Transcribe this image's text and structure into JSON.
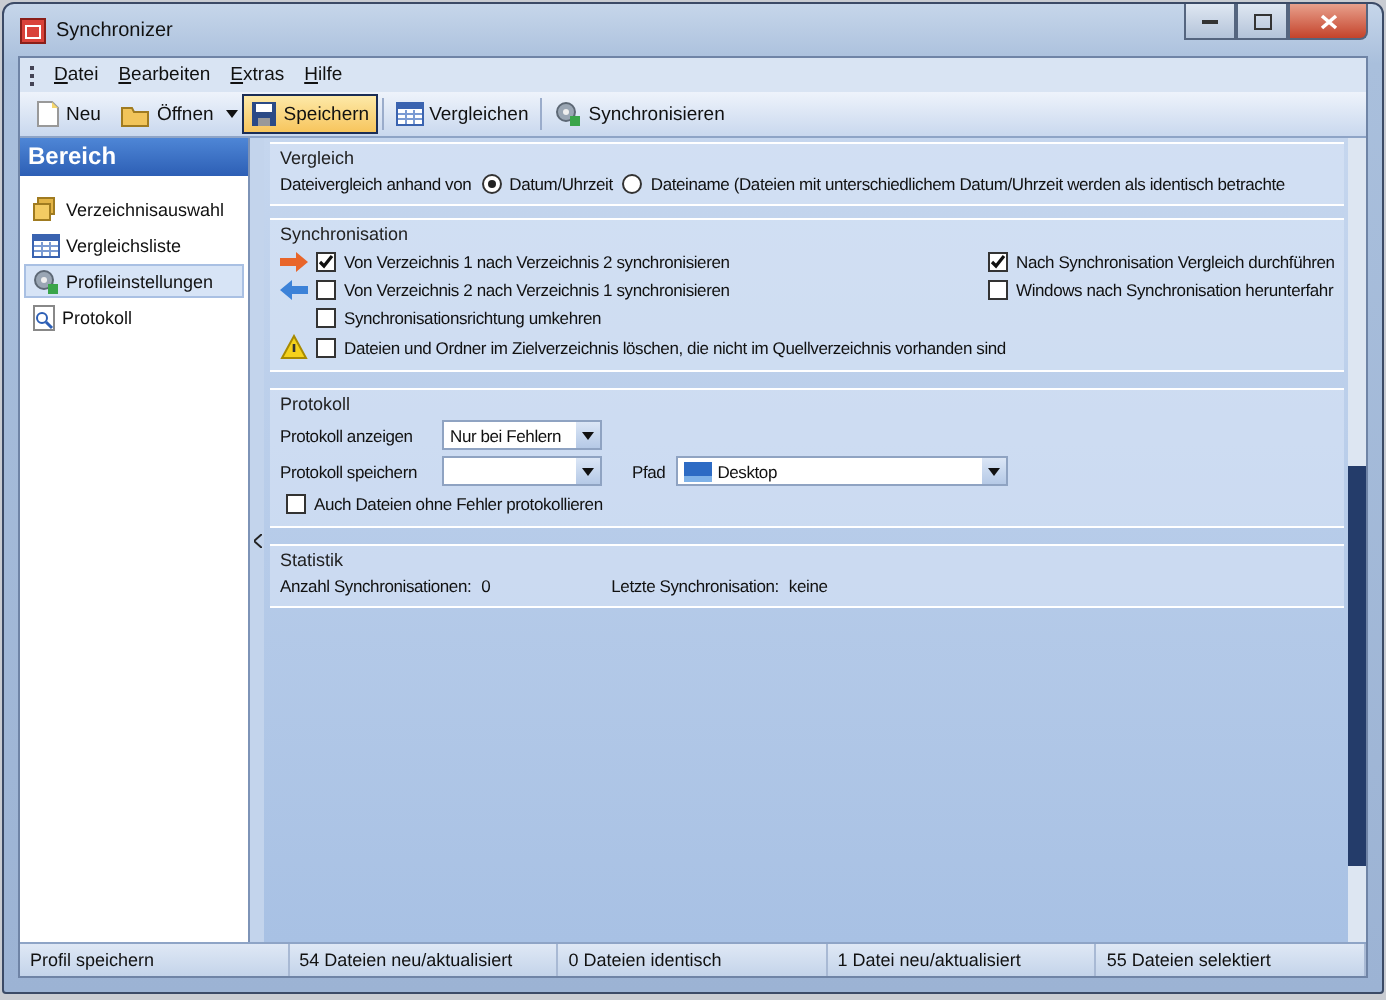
{
  "window": {
    "title": "Synchronizer"
  },
  "menu": [
    "Datei",
    "Bearbeiten",
    "Extras",
    "Hilfe"
  ],
  "toolbar": [
    {
      "label": "Neu",
      "selected": false
    },
    {
      "label": "Öffnen",
      "selected": false
    },
    {
      "label": "Speichern",
      "selected": true
    },
    {
      "label": "Vergleichen",
      "selected": false
    },
    {
      "label": "Synchronisieren",
      "selected": false
    }
  ],
  "sidebar": {
    "title": "Bereich",
    "items": [
      {
        "label": "Verzeichnisauswahl",
        "selected": false
      },
      {
        "label": "Vergleichsliste",
        "selected": false
      },
      {
        "label": "Profileinstellungen",
        "selected": true
      },
      {
        "label": "Protokoll",
        "selected": false
      }
    ]
  },
  "vergleich": {
    "title": "Vergleich",
    "label": "Dateivergleich anhand von",
    "options": [
      {
        "label": "Datum/Uhrzeit",
        "selected": true
      },
      {
        "label": "Dateiname (Dateien mit unterschiedlichem Datum/Uhrzeit werden als identisch betrachte",
        "selected": false
      }
    ]
  },
  "synchronisation": {
    "title": "Synchronisation",
    "options": [
      {
        "label": "Von Verzeichnis 1 nach Verzeichnis 2 synchronisieren",
        "checked": true
      },
      {
        "label": "Von Verzeichnis 2 nach Verzeichnis 1 synchronisieren",
        "checked": false
      },
      {
        "label": "Synchronisationsrichtung umkehren",
        "checked": false
      },
      {
        "label": "Dateien und Ordner im Zielverzeichnis löschen, die nicht im Quellverzeichnis vorhanden sind",
        "checked": false
      }
    ],
    "extra": [
      {
        "label": "Nach Synchronisation Vergleich durchführen",
        "checked": true
      },
      {
        "label": "Windows nach Synchronisation herunterfahr",
        "checked": false
      }
    ]
  },
  "protokoll": {
    "title": "Protokoll",
    "show_label": "Protokoll anzeigen",
    "show_value": "Nur bei Fehlern",
    "save_label": "Protokoll speichern",
    "path_label": "Pfad",
    "path_value": "Desktop",
    "also": {
      "label": "Auch Dateien ohne Fehler protokollieren",
      "checked": false
    }
  },
  "statistik": {
    "title": "Statistik",
    "count_label": "Anzahl Synchronisationen:",
    "count_value": "0",
    "last_label": "Letzte Synchronisation:",
    "last_value": "keine"
  },
  "status_bar": [
    "Profil speichern",
    "54 Dateien neu/aktualisiert",
    "0 Dateien identisch",
    "1 Datei neu/aktualisiert",
    "55 Dateien selektiert"
  ]
}
